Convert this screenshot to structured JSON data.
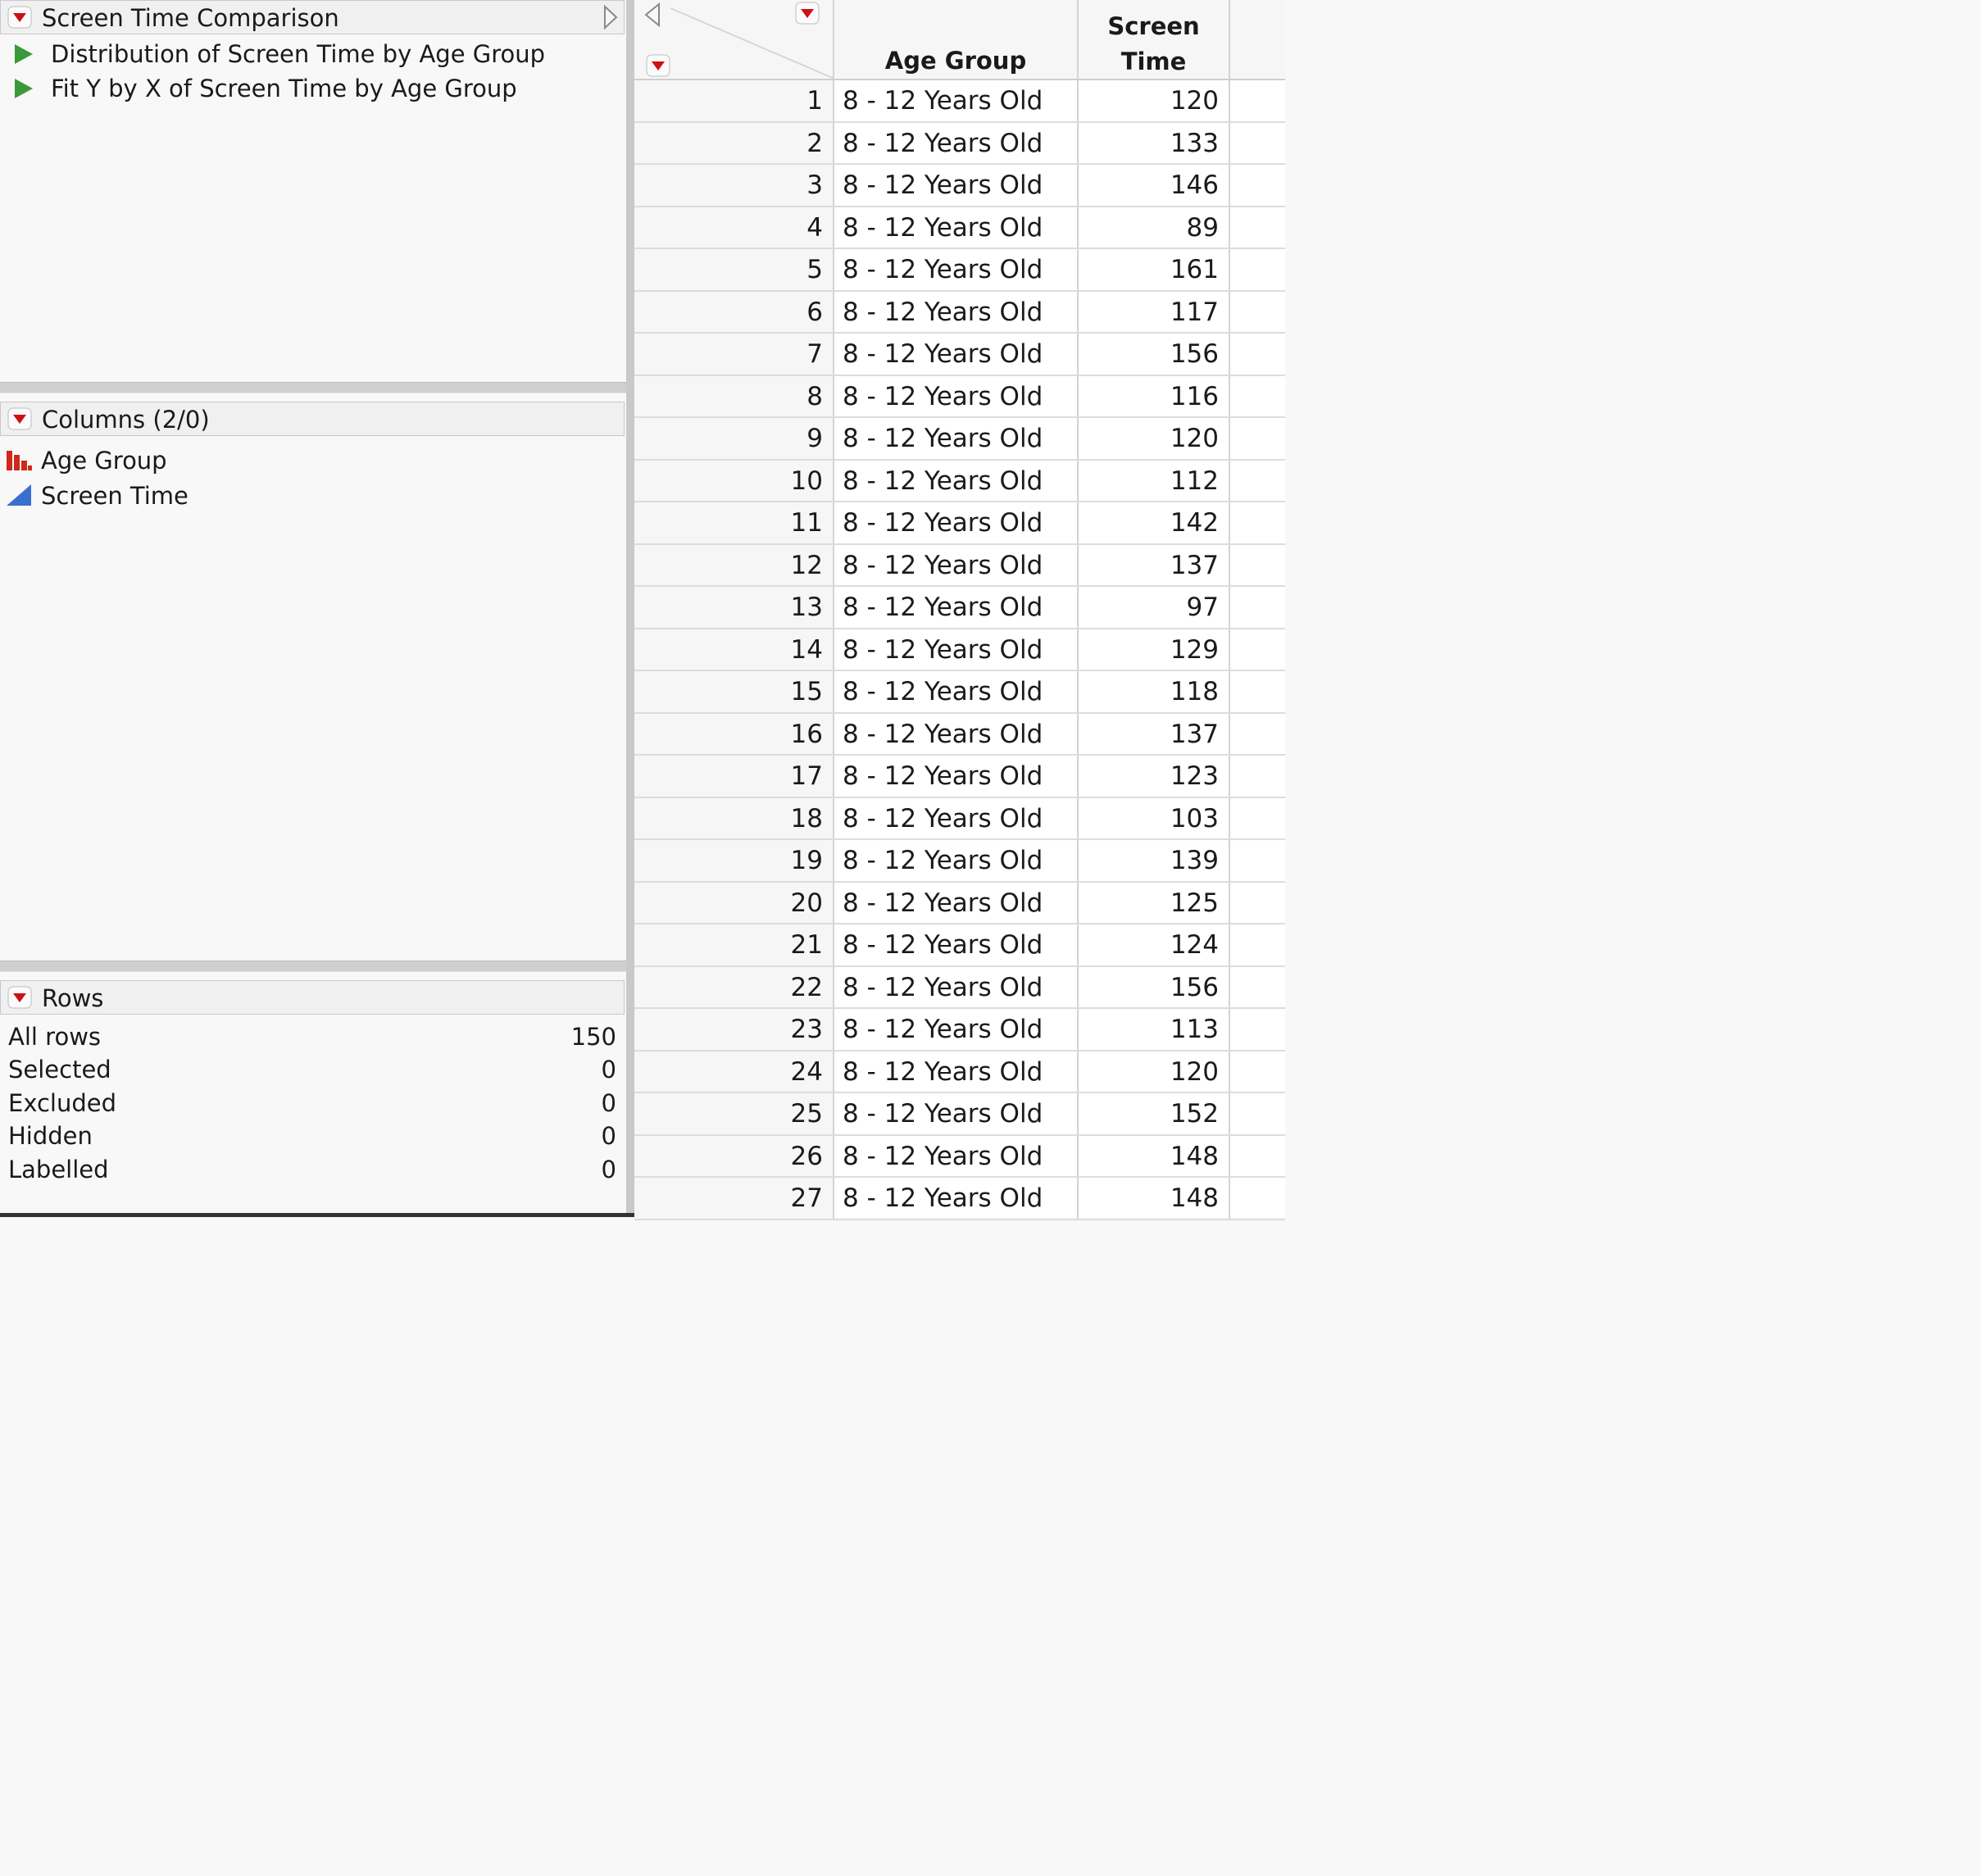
{
  "table_panel": {
    "title": "Screen Time Comparison",
    "scripts": [
      {
        "label": "Distribution of Screen Time by Age Group"
      },
      {
        "label": "Fit Y by X of Screen Time by Age Group"
      }
    ]
  },
  "columns_panel": {
    "title": "Columns (2/0)",
    "items": [
      {
        "label": "Age Group",
        "icon": "nominal-bar-chart-icon"
      },
      {
        "label": "Screen Time",
        "icon": "continuous-triangle-icon"
      }
    ]
  },
  "rows_panel": {
    "title": "Rows",
    "stats": [
      {
        "label": "All rows",
        "value": "150"
      },
      {
        "label": "Selected",
        "value": "0"
      },
      {
        "label": "Excluded",
        "value": "0"
      },
      {
        "label": "Hidden",
        "value": "0"
      },
      {
        "label": "Labelled",
        "value": "0"
      }
    ]
  },
  "grid": {
    "headers": {
      "age_group": "Age Group",
      "screen_time_line1": "Screen",
      "screen_time_line2": "Time"
    },
    "rows": [
      {
        "n": "1",
        "age": "8 - 12 Years Old",
        "time": "120"
      },
      {
        "n": "2",
        "age": "8 - 12 Years Old",
        "time": "133"
      },
      {
        "n": "3",
        "age": "8 - 12 Years Old",
        "time": "146"
      },
      {
        "n": "4",
        "age": "8 - 12 Years Old",
        "time": "89"
      },
      {
        "n": "5",
        "age": "8 - 12 Years Old",
        "time": "161"
      },
      {
        "n": "6",
        "age": "8 - 12 Years Old",
        "time": "117"
      },
      {
        "n": "7",
        "age": "8 - 12 Years Old",
        "time": "156"
      },
      {
        "n": "8",
        "age": "8 - 12 Years Old",
        "time": "116"
      },
      {
        "n": "9",
        "age": "8 - 12 Years Old",
        "time": "120"
      },
      {
        "n": "10",
        "age": "8 - 12 Years Old",
        "time": "112"
      },
      {
        "n": "11",
        "age": "8 - 12 Years Old",
        "time": "142"
      },
      {
        "n": "12",
        "age": "8 - 12 Years Old",
        "time": "137"
      },
      {
        "n": "13",
        "age": "8 - 12 Years Old",
        "time": "97"
      },
      {
        "n": "14",
        "age": "8 - 12 Years Old",
        "time": "129"
      },
      {
        "n": "15",
        "age": "8 - 12 Years Old",
        "time": "118"
      },
      {
        "n": "16",
        "age": "8 - 12 Years Old",
        "time": "137"
      },
      {
        "n": "17",
        "age": "8 - 12 Years Old",
        "time": "123"
      },
      {
        "n": "18",
        "age": "8 - 12 Years Old",
        "time": "103"
      },
      {
        "n": "19",
        "age": "8 - 12 Years Old",
        "time": "139"
      },
      {
        "n": "20",
        "age": "8 - 12 Years Old",
        "time": "125"
      },
      {
        "n": "21",
        "age": "8 - 12 Years Old",
        "time": "124"
      },
      {
        "n": "22",
        "age": "8 - 12 Years Old",
        "time": "156"
      },
      {
        "n": "23",
        "age": "8 - 12 Years Old",
        "time": "113"
      },
      {
        "n": "24",
        "age": "8 - 12 Years Old",
        "time": "120"
      },
      {
        "n": "25",
        "age": "8 - 12 Years Old",
        "time": "152"
      },
      {
        "n": "26",
        "age": "8 - 12 Years Old",
        "time": "148"
      },
      {
        "n": "27",
        "age": "8 - 12 Years Old",
        "time": "148"
      }
    ]
  },
  "colors": {
    "accent_red": "#cc1111",
    "script_green": "#3a9a3a",
    "continuous_blue": "#3a6fd0"
  }
}
